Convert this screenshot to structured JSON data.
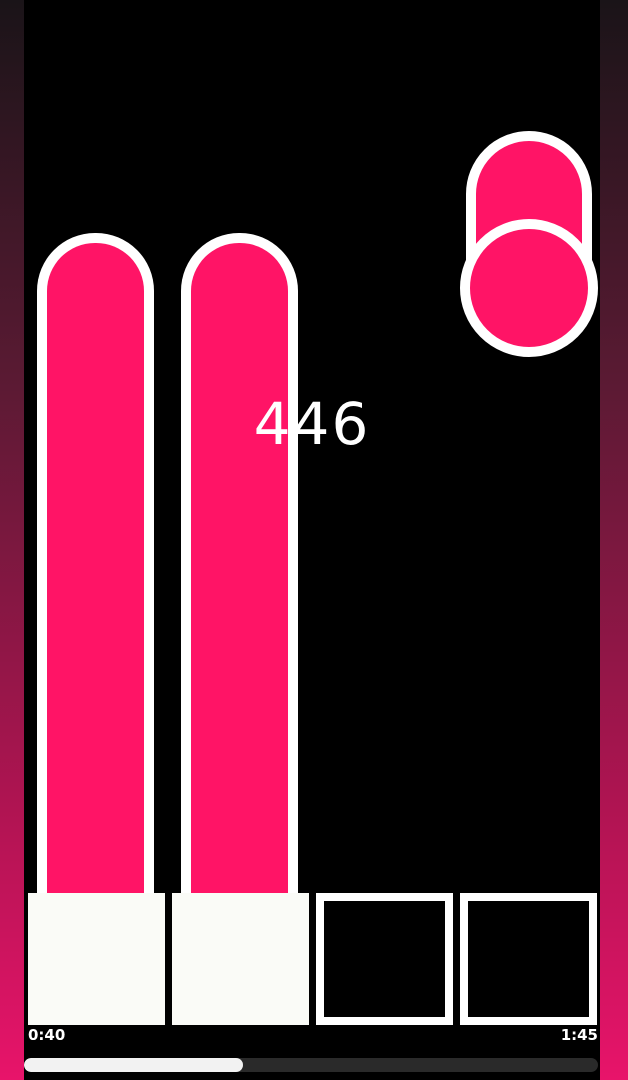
{
  "score": "446",
  "time": {
    "elapsed": "0:40",
    "total": "1:45"
  },
  "progress": {
    "fraction": 0.381
  },
  "colors": {
    "note": "#ff1466",
    "outline": "#ffffff",
    "key_pressed": "#fafbf7",
    "background": "#000000"
  },
  "lanes": [
    {
      "key_state": "pressed",
      "holding": true
    },
    {
      "key_state": "pressed",
      "holding": true
    },
    {
      "key_state": "idle",
      "holding": false
    },
    {
      "key_state": "idle",
      "holding": false
    }
  ],
  "incoming_note": {
    "type": "hold-note-with-head",
    "lane": 4
  }
}
